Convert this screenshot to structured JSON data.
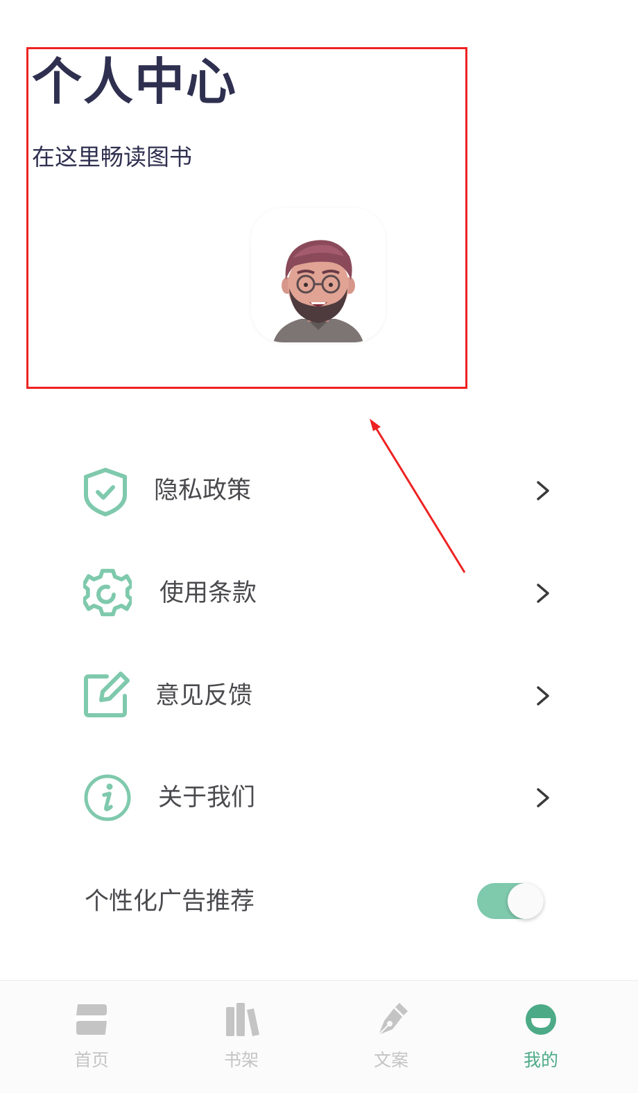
{
  "header": {
    "title": "个人中心",
    "subtitle": "在这里畅读图书"
  },
  "profile": {
    "avatar_icon": "bearded-man-avatar-icon"
  },
  "menu": [
    {
      "label": "隐私政策",
      "icon": "shield-check-icon"
    },
    {
      "label": "使用条款",
      "icon": "gear-icon"
    },
    {
      "label": "意见反馈",
      "icon": "edit-icon"
    },
    {
      "label": "关于我们",
      "icon": "info-icon"
    }
  ],
  "ads_setting": {
    "label": "个性化广告推荐",
    "enabled": true
  },
  "tabbar": {
    "items": [
      {
        "label": "首页",
        "icon": "home-icon",
        "active": false
      },
      {
        "label": "书架",
        "icon": "bookshelf-icon",
        "active": false
      },
      {
        "label": "文案",
        "icon": "pen-icon",
        "active": false
      },
      {
        "label": "我的",
        "icon": "profile-icon",
        "active": true
      }
    ]
  },
  "colors": {
    "accent": "#7fc9ad",
    "active_tab": "#4caa87",
    "title": "#2f3050",
    "annotation": "#ee2222"
  }
}
